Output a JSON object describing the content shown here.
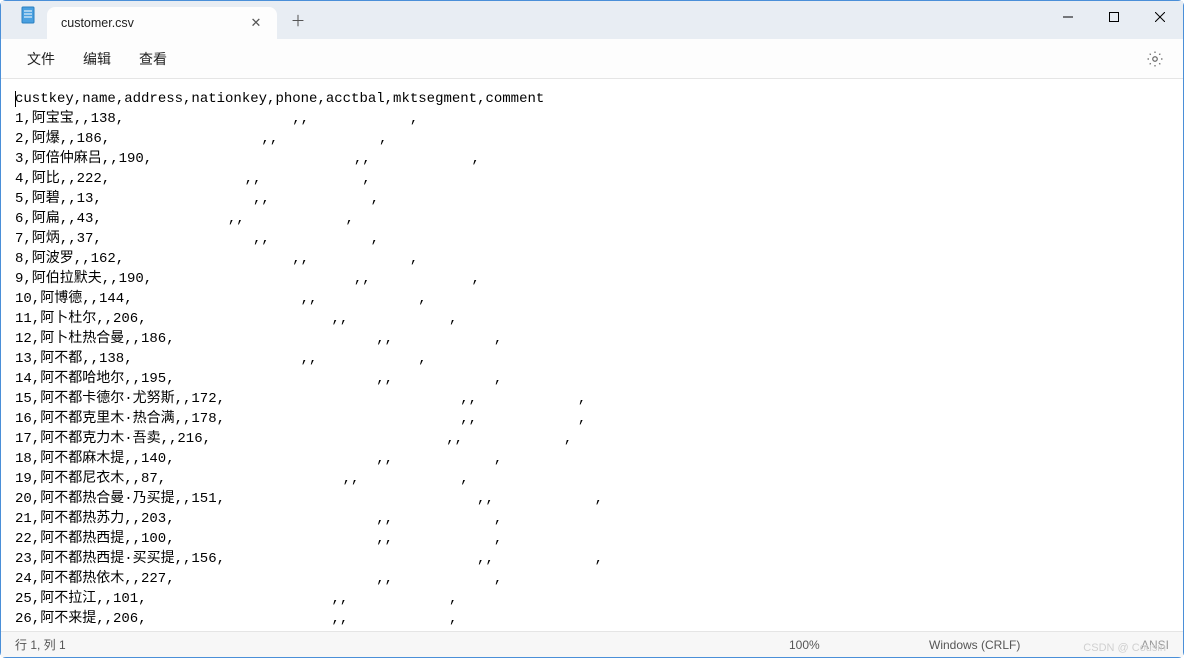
{
  "titlebar": {
    "tab_title": "customer.csv"
  },
  "menu": {
    "file": "文件",
    "edit": "编辑",
    "view": "查看"
  },
  "lines": [
    "custkey,name,address,nationkey,phone,acctbal,mktsegment,comment",
    "1,阿宝宝,,138,                    ,,            ,",
    "2,阿爆,,186,                  ,,            ,",
    "3,阿倍仲麻吕,,190,                        ,,            ,",
    "4,阿比,,222,                ,,            ,",
    "5,阿碧,,13,                  ,,            ,",
    "6,阿扁,,43,               ,,            ,",
    "7,阿炳,,37,                  ,,            ,",
    "8,阿波罗,,162,                    ,,            ,",
    "9,阿伯拉默夫,,190,                        ,,            ,",
    "10,阿博德,,144,                    ,,            ,",
    "11,阿卜杜尔,,206,                      ,,            ,",
    "12,阿卜杜热合曼,,186,                        ,,            ,",
    "13,阿不都,,138,                    ,,            ,",
    "14,阿不都哈地尔,,195,                        ,,            ,",
    "15,阿不都卡德尔·尤努斯,,172,                            ,,            ,",
    "16,阿不都克里木·热合满,,178,                            ,,            ,",
    "17,阿不都克力木·吾卖,,216,                            ,,            ,",
    "18,阿不都麻木提,,140,                        ,,            ,",
    "19,阿不都尼衣木,,87,                     ,,            ,",
    "20,阿不都热合曼·乃买提,,151,                              ,,            ,",
    "21,阿不都热苏力,,203,                        ,,            ,",
    "22,阿不都热西提,,100,                        ,,            ,",
    "23,阿不都热西提·买买提,,156,                              ,,            ,",
    "24,阿不都热依木,,227,                        ,,            ,",
    "25,阿不拉江,,101,                      ,,            ,",
    "26,阿不来提,,206,                      ,,            ,"
  ],
  "status": {
    "position": "行 1, 列 1",
    "zoom": "100%",
    "line_ending": "Windows (CRLF)",
    "encoding": "ANSI"
  },
  "watermark": "CSDN @ Cousin"
}
